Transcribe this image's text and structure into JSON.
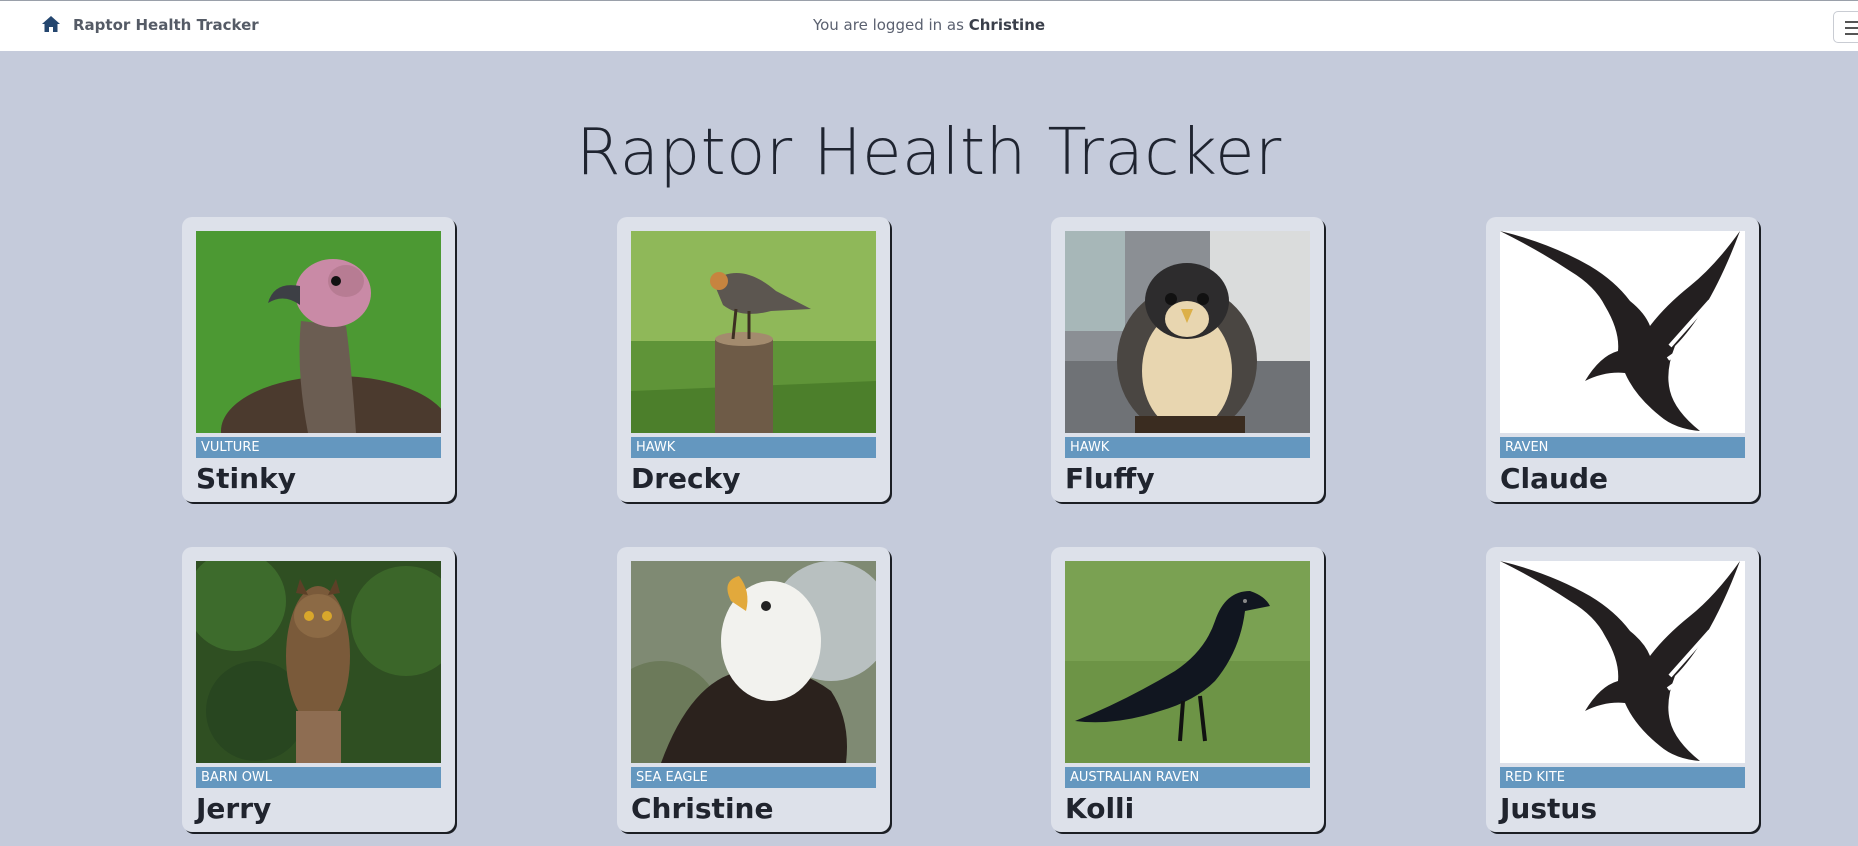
{
  "navbar": {
    "brand": "Raptor Health Tracker",
    "login_prefix": "You are logged in as",
    "user": "Christine"
  },
  "page": {
    "title": "Raptor Health Tracker"
  },
  "birds": [
    {
      "species": "VULTURE",
      "name": "Stinky",
      "icon": "vulture-photo"
    },
    {
      "species": "HAWK",
      "name": "Drecky",
      "icon": "hawk-photo"
    },
    {
      "species": "HAWK",
      "name": "Fluffy",
      "icon": "falcon-photo"
    },
    {
      "species": "RAVEN",
      "name": "Claude",
      "icon": "bird-silhouette-icon"
    },
    {
      "species": "BARN OWL",
      "name": "Jerry",
      "icon": "owl-photo"
    },
    {
      "species": "SEA EAGLE",
      "name": "Christine",
      "icon": "eagle-photo"
    },
    {
      "species": "AUSTRALIAN RAVEN",
      "name": "Kolli",
      "icon": "raven-photo"
    },
    {
      "species": "RED KITE",
      "name": "Justus",
      "icon": "bird-silhouette-icon"
    }
  ],
  "colors": {
    "background": "#c5cbdb",
    "card": "#dde1ea",
    "tag": "#6497bf",
    "navbar": "#ffffff"
  }
}
